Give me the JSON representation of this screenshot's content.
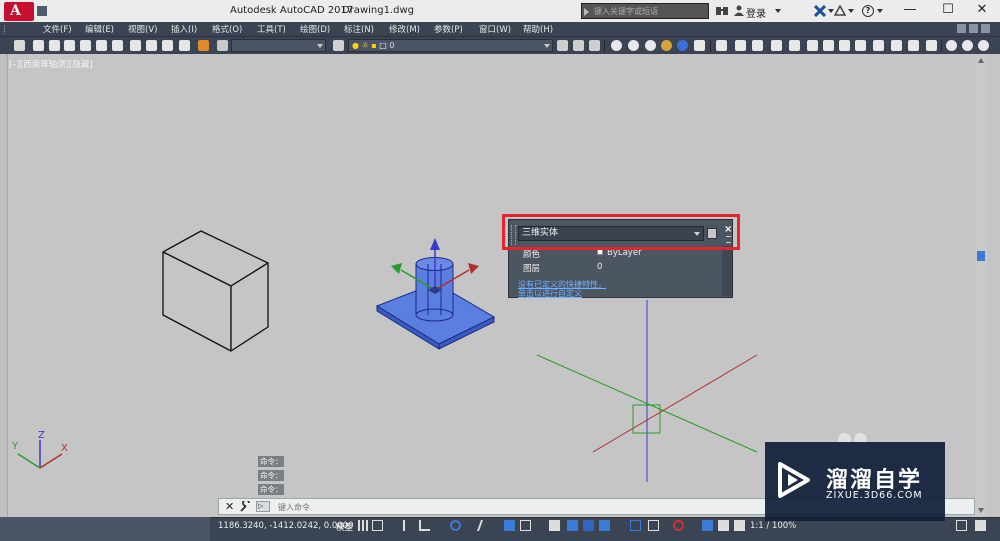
{
  "window": {
    "app_title": "Autodesk AutoCAD 2017",
    "file_title": "Drawing1.dwg",
    "search_placeholder": "键入关键字或短语",
    "login_label": "登录",
    "app_logo_letter": "A",
    "minimize": "—",
    "maximize": "☐",
    "close": "✕"
  },
  "menu": {
    "items": [
      "文件(F)",
      "编辑(E)",
      "视图(V)",
      "插入(I)",
      "格式(O)",
      "工具(T)",
      "绘图(D)",
      "标注(N)",
      "修改(M)",
      "参数(P)",
      "窗口(W)",
      "帮助(H)"
    ]
  },
  "toolbar": {
    "layer_value": "0"
  },
  "viewport": {
    "label": "[–][西南等轴测][隐藏]"
  },
  "quick_properties": {
    "object_type": "三维实体",
    "rows": [
      {
        "label": "颜色",
        "value": "ByLayer"
      },
      {
        "label": "图层",
        "value": "0"
      }
    ],
    "link_1": "没有已定义的快捷特性，",
    "link_2": "单击以进行自定义",
    "close_symbol": "×"
  },
  "command": {
    "history": [
      "命令：",
      "命令：",
      "命令："
    ],
    "close_symbol": "✕",
    "prompt_symbol": "▷",
    "placeholder": "键入命令"
  },
  "status": {
    "coords": "1186.3240, -1412.0242, 0.0000",
    "model": "模型",
    "scale": "1:1 / 100%"
  },
  "ucs": {
    "x": "X",
    "y": "Y",
    "z": "Z"
  },
  "watermark": {
    "name": "溜溜自学",
    "url": "ZIXUE.3D66.COM"
  },
  "colors": {
    "dark_chrome": "#3b4453",
    "canvas": "#c5c5c5",
    "highlight_red": "#e4262c",
    "selected_solid": "#5b7fe0",
    "axis_x": "#b03030",
    "axis_y": "#2a9a2a",
    "axis_z": "#3a3acc"
  }
}
